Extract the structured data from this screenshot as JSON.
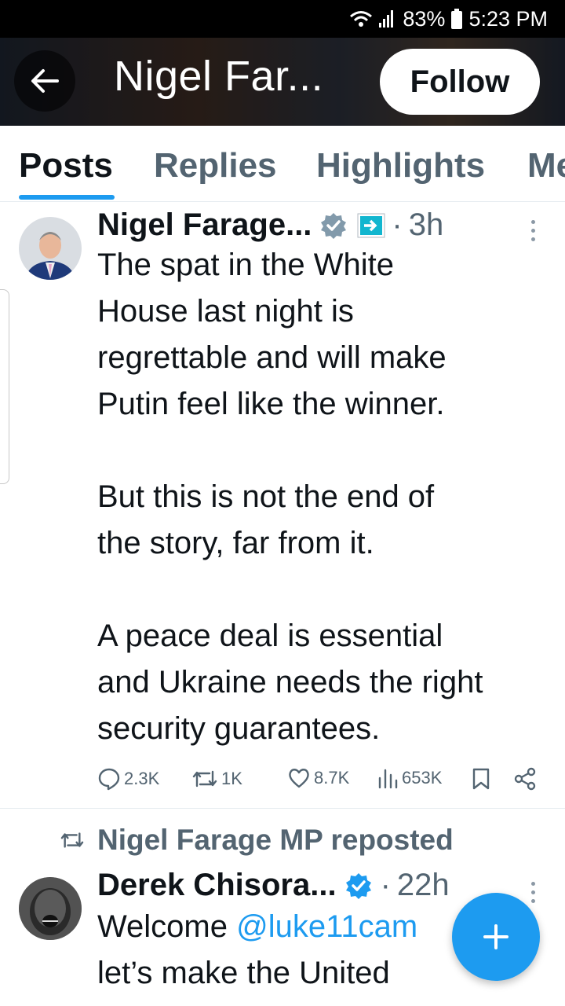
{
  "status_bar": {
    "battery": "83%",
    "time": "5:23 PM"
  },
  "header": {
    "title": "Nigel Far...",
    "follow_label": "Follow"
  },
  "tabs": [
    {
      "label": "Posts"
    },
    {
      "label": "Replies"
    },
    {
      "label": "Highlights"
    },
    {
      "label": "Me"
    }
  ],
  "posts": [
    {
      "display_name": "Nigel Farage...",
      "affiliation_badge": "REFORM UK",
      "separator": "·",
      "time": "3h",
      "text": "The spat in the White\nHouse last night is\nregrettable and will make\nPutin feel like the winner.\n\nBut this is not the end of\nthe story, far from it.\n\nA peace deal is essential\nand Ukraine needs the right\nsecurity guarantees.",
      "stats": {
        "replies": "2.3K",
        "reposts": "1K",
        "likes": "8.7K",
        "views": "653K"
      }
    },
    {
      "repost_label": "Nigel Farage MP reposted",
      "display_name": "Derek Chisora...",
      "separator": "·",
      "time": "22h",
      "text_prefix": "Welcome ",
      "mention": "@luke11cam",
      "text_line2": "let’s make the United"
    }
  ],
  "colors": {
    "accent": "#1d9bf0",
    "verified": "#1d9bf0",
    "affiliate": "#829aab"
  }
}
